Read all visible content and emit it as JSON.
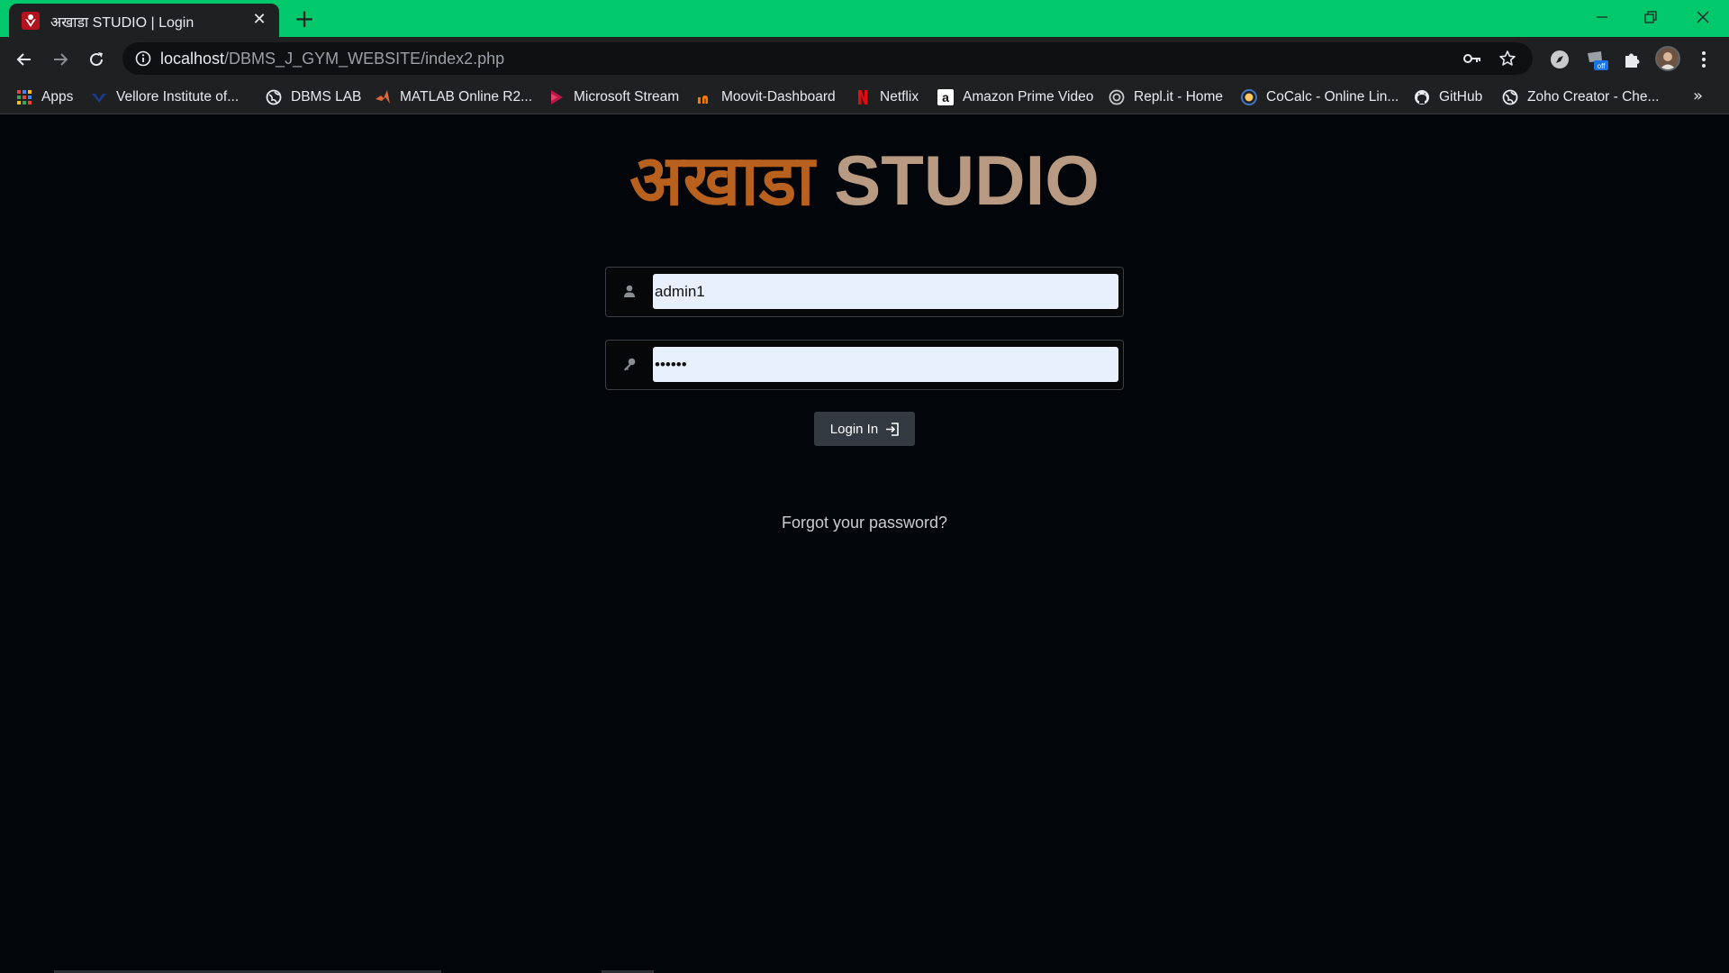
{
  "browser": {
    "tab": {
      "title": "अखाडा STUDIO | Login",
      "close": "✕"
    },
    "new_tab": "+",
    "url": {
      "host": "localhost",
      "path": "/DBMS_J_GYM_WEBSITE/index2.php"
    },
    "extension_badge": "off",
    "bookmarks": [
      {
        "label": "Apps",
        "icon": "apps-grid-icon"
      },
      {
        "label": "Vellore Institute of...",
        "icon": "vit-icon"
      },
      {
        "label": "DBMS LAB",
        "icon": "globe-icon"
      },
      {
        "label": "MATLAB Online R2...",
        "icon": "matlab-icon"
      },
      {
        "label": "Microsoft Stream",
        "icon": "stream-icon"
      },
      {
        "label": "Moovit-Dashboard",
        "icon": "moovit-icon"
      },
      {
        "label": "Netflix",
        "icon": "netflix-icon"
      },
      {
        "label": "Amazon Prime Video",
        "icon": "amazon-icon"
      },
      {
        "label": "Repl.it - Home",
        "icon": "replit-icon"
      },
      {
        "label": "CoCalc - Online Lin...",
        "icon": "cocalc-icon"
      },
      {
        "label": "GitHub",
        "icon": "github-icon"
      },
      {
        "label": "Zoho Creator - Che...",
        "icon": "globe-icon"
      }
    ],
    "bookmarks_more": "»"
  },
  "page": {
    "brand_hindi": "अखाडा",
    "brand_english": "STUDIO",
    "username_value": "admin1",
    "password_value": "••••••",
    "login_button": "Login In",
    "forgot_link": "Forgot your password?"
  },
  "colors": {
    "tabstrip": "#00c86b",
    "brand_hindi": "#b8601e",
    "brand_english": "#b89a82",
    "page_bg": "#020509",
    "autofill_bg": "#e8f0fe"
  }
}
